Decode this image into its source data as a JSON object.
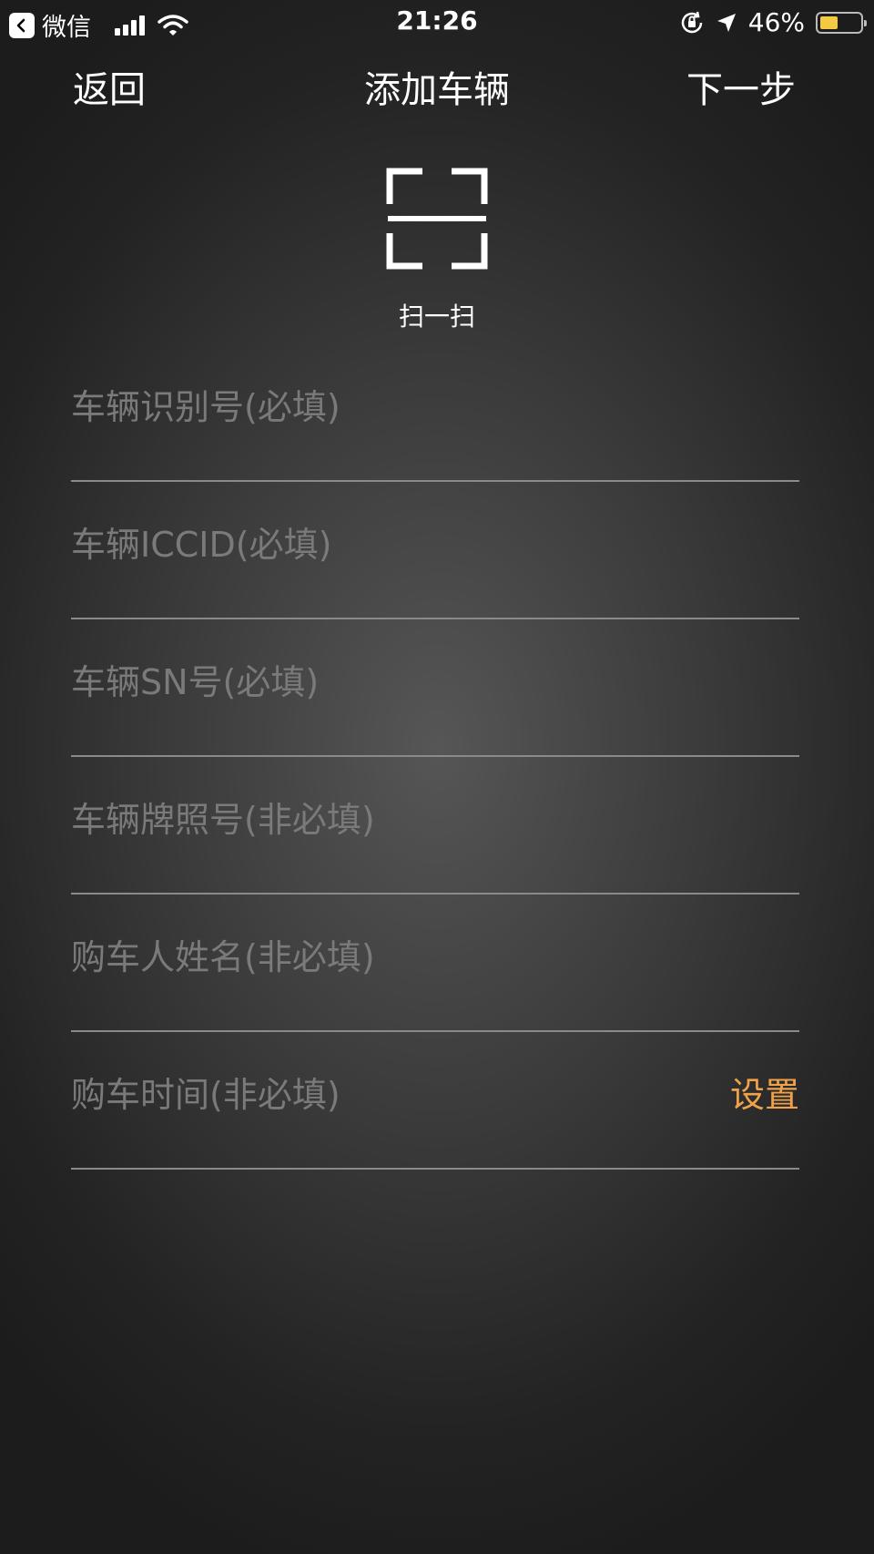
{
  "status_bar": {
    "app": "微信",
    "time": "21:26",
    "battery": "46%",
    "battery_level": 0.46,
    "battery_color": "#f3c842"
  },
  "nav": {
    "back": "返回",
    "title": "添加车辆",
    "next": "下一步"
  },
  "scan": {
    "label": "扫一扫",
    "icon": "scan-icon"
  },
  "fields": [
    {
      "label": "车辆识别号(必填)"
    },
    {
      "label": "车辆ICCID(必填)"
    },
    {
      "label": "车辆SN号(必填)"
    },
    {
      "label": "车辆牌照号(非必填)"
    },
    {
      "label": "购车人姓名(非必填)"
    },
    {
      "label": "购车时间(非必填)",
      "action": "设置"
    }
  ],
  "colors": {
    "accent": "#f0a24a",
    "placeholder": "#7a7a7a",
    "divider": "#8a8a8a"
  }
}
